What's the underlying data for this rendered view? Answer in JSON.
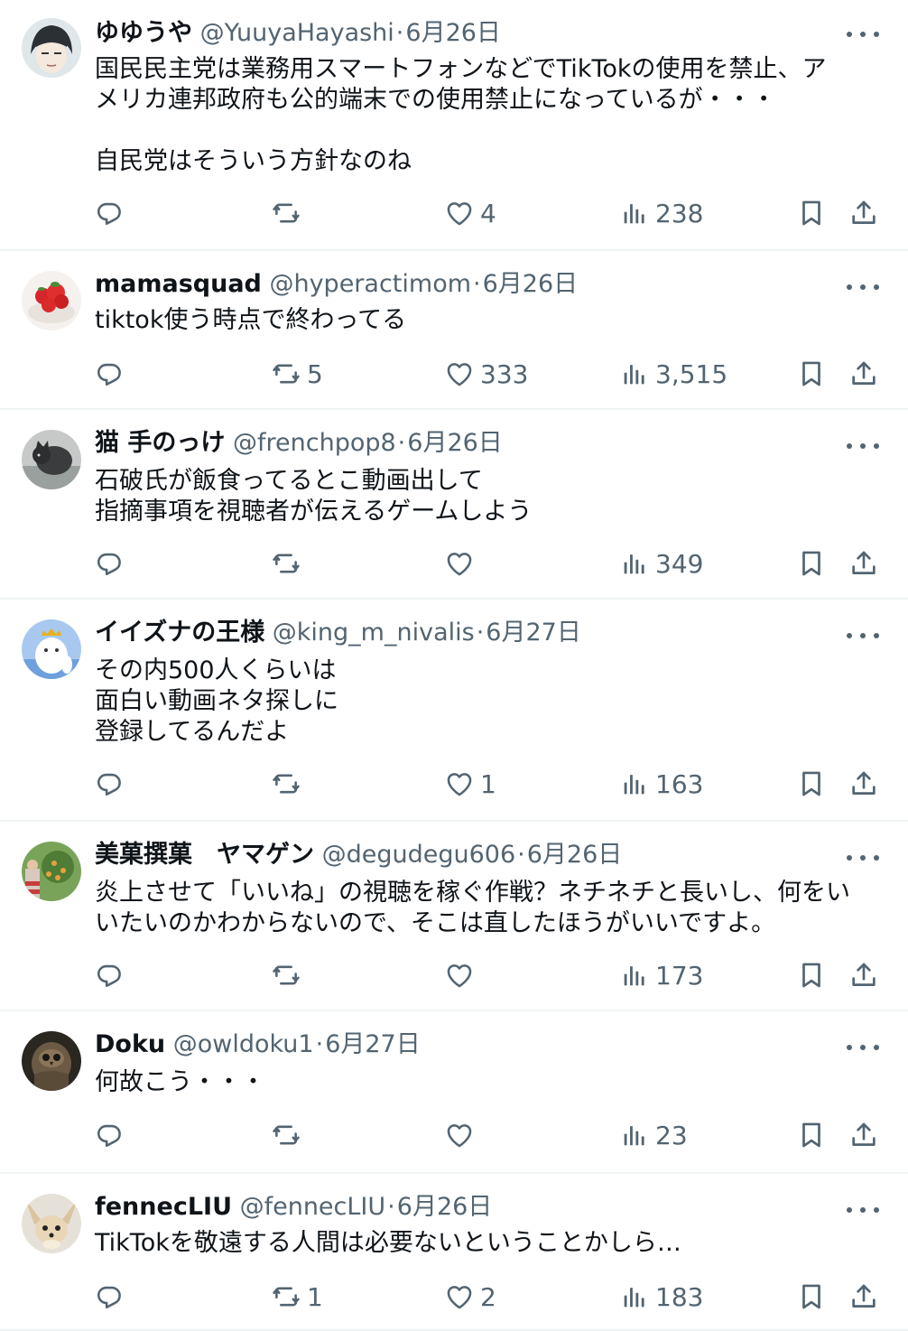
{
  "colors": {
    "text": "#0f1419",
    "secondary": "#536471",
    "divider": "#eff3f4"
  },
  "tweets": [
    {
      "name": "ゆゆうや",
      "handle": "@YuuyaHayashi",
      "date": "6月26日",
      "text": "国民民主党は業務用スマートフォンなどでTikTokの使用を禁止、ア\nメリカ連邦政府も公的端末での使用禁止になっているが・・・\n\n自民党はそういう方針なのね",
      "replies": "",
      "retweets": "",
      "likes": "4",
      "views": "238"
    },
    {
      "name": "mamasquad",
      "handle": "@hyperactimom",
      "date": "6月26日",
      "text": "tiktok使う時点で終わってる",
      "replies": "",
      "retweets": "5",
      "likes": "333",
      "views": "3,515"
    },
    {
      "name": "猫 手のっけ",
      "handle": "@frenchpop8",
      "date": "6月26日",
      "text": "石破氏が飯食ってるとこ動画出して\n指摘事項を視聴者が伝えるゲームしよう",
      "replies": "",
      "retweets": "",
      "likes": "",
      "views": "349"
    },
    {
      "name": "イイズナの王様",
      "handle": "@king_m_nivalis",
      "date": "6月27日",
      "text": "その内500人くらいは\n面白い動画ネタ探しに\n登録してるんだよ",
      "replies": "",
      "retweets": "",
      "likes": "1",
      "views": "163"
    },
    {
      "name": "美菓撰菓　ヤマゲン",
      "handle": "@degudegu606",
      "date": "6月26日",
      "text": "炎上させて「いいね」の視聴を稼ぐ作戦？ネチネチと長いし、何をい\nいたいのかわからないので、そこは直したほうがいいですよ。",
      "replies": "",
      "retweets": "",
      "likes": "",
      "views": "173"
    },
    {
      "name": "Doku",
      "handle": "@owldoku1",
      "date": "6月27日",
      "text": "何故こう・・・",
      "replies": "",
      "retweets": "",
      "likes": "",
      "views": "23"
    },
    {
      "name": "fennecLIU",
      "handle": "@fennecLIU",
      "date": "6月26日",
      "text": "TikTokを敬遠する人間は必要ないということかしら…",
      "replies": "",
      "retweets": "1",
      "likes": "2",
      "views": "183"
    }
  ]
}
